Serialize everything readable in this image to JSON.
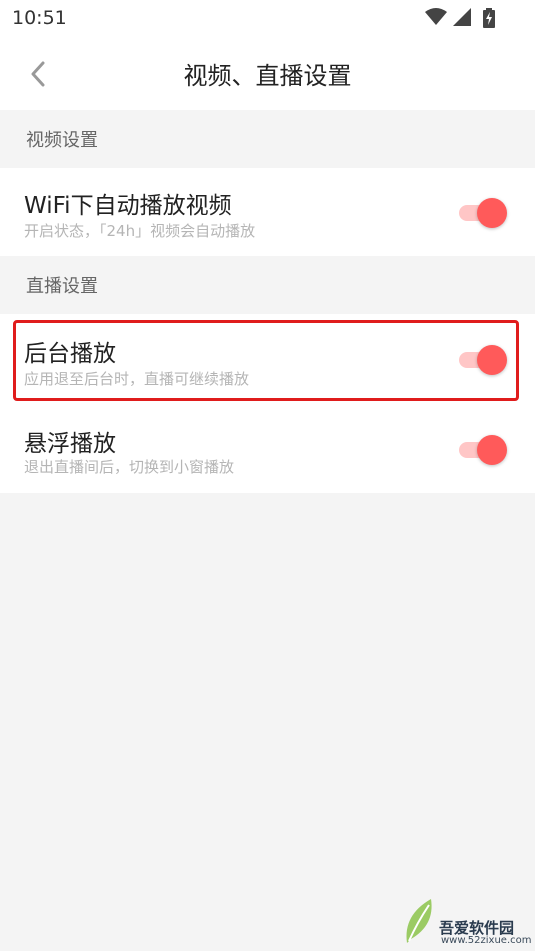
{
  "status_bar": {
    "time": "10:51"
  },
  "header": {
    "title": "视频、直播设置"
  },
  "sections": [
    {
      "header": "视频设置",
      "items": [
        {
          "title": "WiFi下自动播放视频",
          "subtitle": "开启状态，「24h」视频会自动播放",
          "enabled": true
        }
      ]
    },
    {
      "header": "直播设置",
      "items": [
        {
          "title": "后台播放",
          "subtitle": "应用退至后台时，直播可继续播放",
          "enabled": true
        },
        {
          "title": "悬浮播放",
          "subtitle": "退出直播间后，切换到小窗播放",
          "enabled": true
        }
      ]
    }
  ],
  "watermark": {
    "brand": "吾爱软件园",
    "url": "www.52zixue.com"
  },
  "colors": {
    "accent": "#ff5a5a",
    "accent_track": "#ffc6c6",
    "highlight": "#e01c1c"
  }
}
